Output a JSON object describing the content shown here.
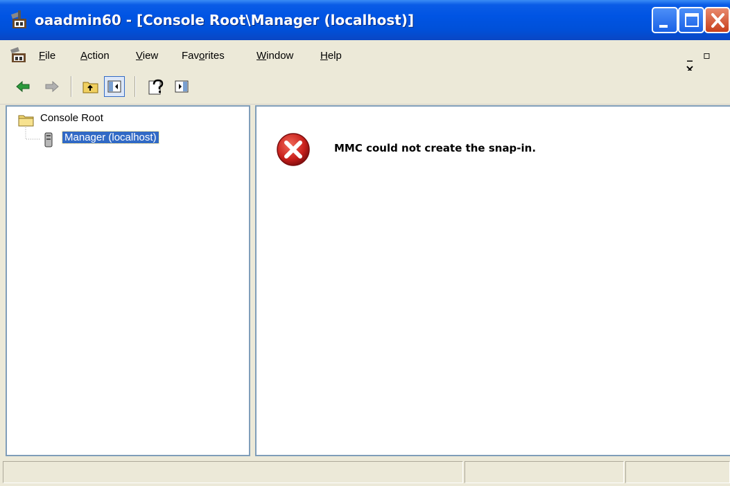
{
  "window": {
    "title": "oaadmin60 - [Console Root\\Manager (localhost)]"
  },
  "menu": {
    "items": [
      {
        "label": "File",
        "mnemonic": "F"
      },
      {
        "label": "Action",
        "mnemonic": "A"
      },
      {
        "label": "View",
        "mnemonic": "V"
      },
      {
        "label": "Favorites",
        "mnemonic": "o"
      },
      {
        "label": "Window",
        "mnemonic": "W"
      },
      {
        "label": "Help",
        "mnemonic": "H"
      }
    ],
    "mdi_controls": [
      "_",
      "▫",
      "×"
    ]
  },
  "toolbar": {
    "buttons": [
      "back-icon",
      "forward-icon",
      "up-one-level-icon",
      "show-hide-console-tree-icon",
      "help-icon",
      "show-hide-action-pane-icon"
    ]
  },
  "tree": {
    "root": {
      "label": "Console Root"
    },
    "child": {
      "label": "Manager (localhost)",
      "selected": true
    }
  },
  "result": {
    "message": "MMC could not create the snap-in."
  },
  "colors": {
    "titlebar": "#0054e3",
    "selection": "#316ac5",
    "error": "#c8201c"
  }
}
